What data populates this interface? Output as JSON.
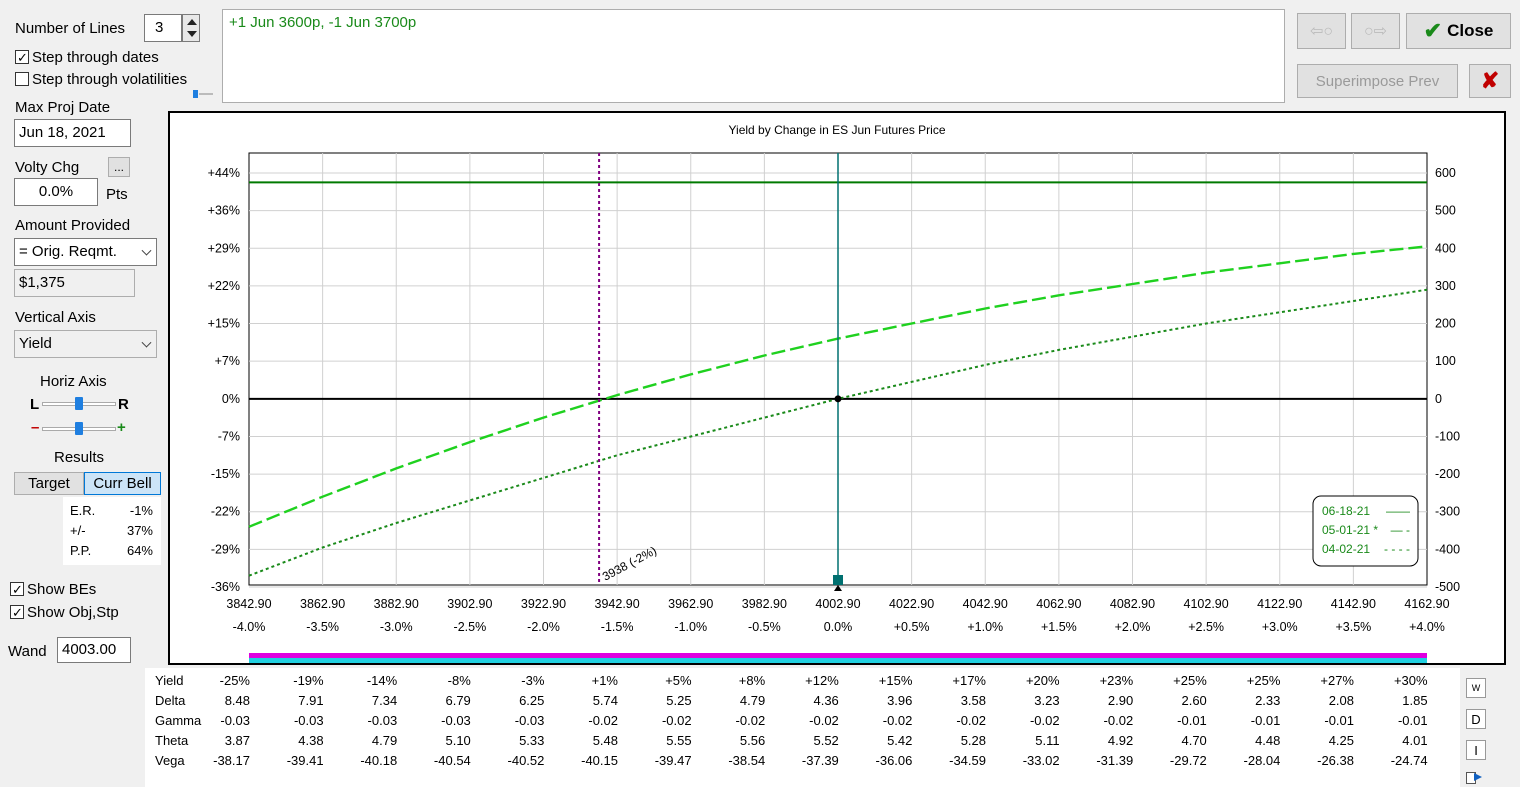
{
  "controls": {
    "num_lines_label": "Number of Lines",
    "num_lines_value": "3",
    "step_dates_label": "Step through dates",
    "step_dates_checked": true,
    "step_vols_label": "Step through volatilities",
    "step_vols_checked": false,
    "max_proj_date_label": "Max Proj Date",
    "max_proj_date_value": "Jun 18, 2021",
    "volty_chg_label": "Volty Chg",
    "volty_chg_ellipsis": "...",
    "volty_chg_value": "0.0%",
    "volty_chg_unit": "Pts",
    "amount_provided_label": "Amount Provided",
    "amount_provided_value": "= Orig. Reqmt.",
    "amount_value": "$1,375",
    "vertical_axis_label": "Vertical Axis",
    "vertical_axis_value": "Yield",
    "horiz_axis_label": "Horiz Axis",
    "horiz_left": "L",
    "horiz_right": "R",
    "minus": "–",
    "plus": "+",
    "results_label": "Results",
    "target_button": "Target",
    "curr_bell_button": "Curr Bell",
    "results": [
      {
        "k": "E.R.",
        "v": "-1%"
      },
      {
        "k": "+/-",
        "v": "37%"
      },
      {
        "k": "P.P.",
        "v": "64%"
      }
    ],
    "show_bes_label": "Show BEs",
    "show_bes_checked": true,
    "show_obj_label": "Show Obj,Stp",
    "show_obj_checked": true,
    "wand_label": "Wand",
    "wand_value": "4003.00"
  },
  "position_text": "+1 Jun 3600p, -1 Jun 3700p",
  "toolbar": {
    "prev_icon": "⇦○",
    "next_icon": "○⇨",
    "close_label": "Close",
    "superimpose_label": "Superimpose Prev",
    "cancel_icon": "✘"
  },
  "colors": {
    "accent_green": "#1a8a1a",
    "line_green": "#007a00",
    "dash_green": "#1fd11f",
    "be_purple": "#800080",
    "current_teal": "#007070",
    "magenta_bar": "#e000e0",
    "cyan_bar": "#20d0e0"
  },
  "chart_data": {
    "type": "line",
    "title": "Yield by Change in ES Jun Futures Price",
    "x_prices": [
      "3842.90",
      "3862.90",
      "3882.90",
      "3902.90",
      "3922.90",
      "3942.90",
      "3962.90",
      "3982.90",
      "4002.90",
      "4022.90",
      "4042.90",
      "4062.90",
      "4082.90",
      "4102.90",
      "4122.90",
      "4142.90",
      "4162.90"
    ],
    "x_pcts": [
      "-4.0%",
      "-3.5%",
      "-3.0%",
      "-2.5%",
      "-2.0%",
      "-1.5%",
      "-1.0%",
      "-0.5%",
      "0.0%",
      "+0.5%",
      "+1.0%",
      "+1.5%",
      "+2.0%",
      "+2.5%",
      "+3.0%",
      "+3.5%",
      "+4.0%"
    ],
    "xlim": [
      3842.9,
      4162.9
    ],
    "y_left_ticks": [
      "+44%",
      "+36%",
      "+29%",
      "+22%",
      "+15%",
      "+7%",
      "0%",
      "-7%",
      "-15%",
      "-22%",
      "-29%",
      "-36%"
    ],
    "y_right_ticks": [
      "600",
      "500",
      "400",
      "300",
      "200",
      "100",
      "0",
      "-100",
      "-200",
      "-300",
      "-400",
      "-500"
    ],
    "y_right_values": [
      600,
      500,
      400,
      300,
      200,
      100,
      0,
      -100,
      -200,
      -300,
      -400,
      -500
    ],
    "ylim": [
      -500,
      600
    ],
    "series": [
      {
        "name": "06-18-21",
        "style": "solid",
        "x": [
          3842.9,
          4162.9
        ],
        "y": [
          575,
          575
        ]
      },
      {
        "name": "05-01-21 *",
        "style": "dashed",
        "x": [
          3842.9,
          3862.9,
          3882.9,
          3902.9,
          3922.9,
          3942.9,
          3962.9,
          3982.9,
          4002.9,
          4022.9,
          4042.9,
          4062.9,
          4082.9,
          4102.9,
          4122.9,
          4142.9,
          4162.9
        ],
        "y": [
          -340,
          -260,
          -185,
          -115,
          -50,
          10,
          65,
          115,
          160,
          200,
          240,
          275,
          305,
          335,
          360,
          385,
          405
        ]
      },
      {
        "name": "04-02-21",
        "style": "dotted",
        "x": [
          3842.9,
          3862.9,
          3882.9,
          3902.9,
          3922.9,
          3942.9,
          3962.9,
          3982.9,
          4002.9,
          4022.9,
          4042.9,
          4062.9,
          4082.9,
          4102.9,
          4122.9,
          4142.9,
          4162.9
        ],
        "y": [
          -470,
          -395,
          -330,
          -270,
          -210,
          -150,
          -100,
          -50,
          0,
          45,
          90,
          130,
          165,
          200,
          230,
          260,
          290
        ]
      }
    ],
    "breakeven": {
      "x": 3938,
      "label": "3938 (-2%)"
    },
    "current_price": 4002.9,
    "legend": [
      {
        "label": "06-18-21",
        "style": "——"
      },
      {
        "label": "05-01-21 *",
        "style": "— -"
      },
      {
        "label": "04-02-21",
        "style": "- - - -"
      }
    ],
    "legend_position": "right",
    "grid": true
  },
  "greeks": {
    "rows": [
      {
        "label": "Yield",
        "values": [
          "-25%",
          "-19%",
          "-14%",
          "-8%",
          "-3%",
          "+1%",
          "+5%",
          "+8%",
          "+12%",
          "+15%",
          "+17%",
          "+20%",
          "+23%",
          "+25%",
          "+25%",
          "+27%",
          "+30%"
        ]
      },
      {
        "label": "Delta",
        "values": [
          "8.48",
          "7.91",
          "7.34",
          "6.79",
          "6.25",
          "5.74",
          "5.25",
          "4.79",
          "4.36",
          "3.96",
          "3.58",
          "3.23",
          "2.90",
          "2.60",
          "2.33",
          "2.08",
          "1.85"
        ]
      },
      {
        "label": "Gamma",
        "values": [
          "-0.03",
          "-0.03",
          "-0.03",
          "-0.03",
          "-0.03",
          "-0.02",
          "-0.02",
          "-0.02",
          "-0.02",
          "-0.02",
          "-0.02",
          "-0.02",
          "-0.02",
          "-0.01",
          "-0.01",
          "-0.01",
          "-0.01"
        ]
      },
      {
        "label": "Theta",
        "values": [
          "3.87",
          "4.38",
          "4.79",
          "5.10",
          "5.33",
          "5.48",
          "5.55",
          "5.56",
          "5.52",
          "5.42",
          "5.28",
          "5.11",
          "4.92",
          "4.70",
          "4.48",
          "4.25",
          "4.01"
        ]
      },
      {
        "label": "Vega",
        "values": [
          "-38.17",
          "-39.41",
          "-40.18",
          "-40.54",
          "-40.52",
          "-40.15",
          "-39.47",
          "-38.54",
          "-37.39",
          "-36.06",
          "-34.59",
          "-33.02",
          "-31.39",
          "-29.72",
          "-28.04",
          "-26.38",
          "-24.74"
        ]
      }
    ],
    "side_buttons": [
      "W",
      "D",
      "I"
    ]
  }
}
